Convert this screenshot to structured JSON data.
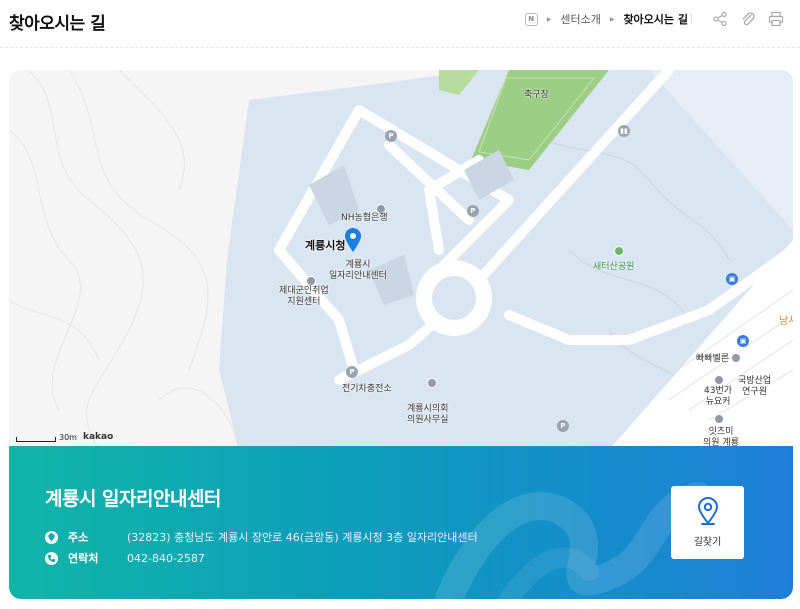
{
  "header": {
    "title": "찾아오시는 길",
    "breadcrumb": {
      "home_icon": "home-icon",
      "parent": "센터소개",
      "current": "찾아오시는 길"
    },
    "tools": [
      "share-icon",
      "clip-icon",
      "print-icon"
    ]
  },
  "map": {
    "labels": {
      "soccer": "축구장",
      "nh_bank": "NH농협은행",
      "city_hall": "계룡시청",
      "job_center": "계룡시\n일자리안내센터",
      "veteran": "제대군인취업\n지원센터",
      "park": "새터산공원",
      "ev_station": "전기차충전소",
      "council": "계룡시의회\n의원사무실",
      "bakery": "빠빠벨른",
      "defense": "국방산업\n연구원",
      "store43": "43번가\n뉴요커",
      "partial_bottom": "잇츠미\n의원 계룡",
      "partial_right": "남서"
    },
    "scale": "30m",
    "provider": "kakao"
  },
  "info": {
    "name": "계룡시 일자리안내센터",
    "address_label": "주소",
    "address": "(32823) 충청남도 계룡시 장안로 46(금암동) 계룡시청 3층 일자리안내센터",
    "contact_label": "연락처",
    "contact": "042-840-2587",
    "route_button": "길찾기"
  },
  "colors": {
    "accent_start": "#12b5a8",
    "accent_end": "#1e7fd9",
    "water": "#d9e6f2",
    "road": "#ffffff",
    "field": "#9ccf84"
  }
}
